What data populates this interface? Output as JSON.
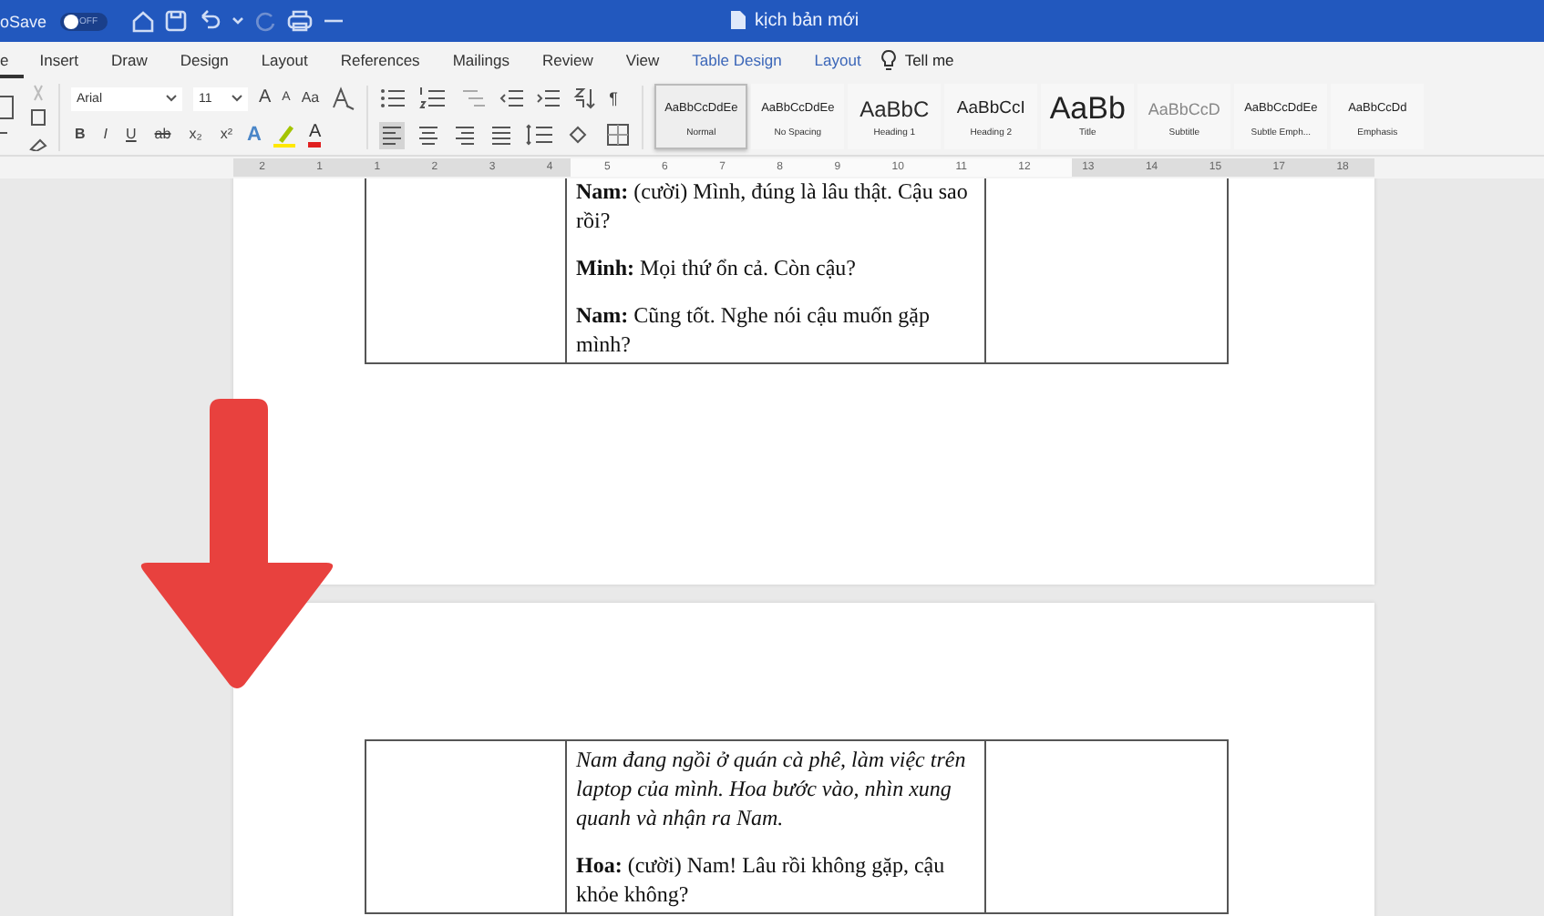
{
  "title_bar": {
    "autosave_label": "oSave",
    "autosave_toggle": {
      "label": "OFF",
      "on": false
    },
    "document_title": "kịch bản mới"
  },
  "tabs": [
    {
      "label": "e",
      "selected": true,
      "contextual": false
    },
    {
      "label": "Insert",
      "selected": false,
      "contextual": false
    },
    {
      "label": "Draw",
      "selected": false,
      "contextual": false
    },
    {
      "label": "Design",
      "selected": false,
      "contextual": false
    },
    {
      "label": "Layout",
      "selected": false,
      "contextual": false
    },
    {
      "label": "References",
      "selected": false,
      "contextual": false
    },
    {
      "label": "Mailings",
      "selected": false,
      "contextual": false
    },
    {
      "label": "Review",
      "selected": false,
      "contextual": false
    },
    {
      "label": "View",
      "selected": false,
      "contextual": false
    },
    {
      "label": "Table Design",
      "selected": false,
      "contextual": true
    },
    {
      "label": "Layout",
      "selected": false,
      "contextual": true
    }
  ],
  "tell_me": "Tell me",
  "ribbon": {
    "font_name": "Arial",
    "font_size": "11",
    "grow_font": "A",
    "shrink_font": "A",
    "change_case": "Aa",
    "format_buttons": [
      {
        "label": "B",
        "kind": "bold"
      },
      {
        "label": "I",
        "kind": "italic"
      },
      {
        "label": "U",
        "kind": "underline"
      },
      {
        "label": "ab",
        "kind": "strike"
      },
      {
        "label": "x₂",
        "kind": "sub"
      },
      {
        "label": "x²",
        "kind": "sup"
      }
    ],
    "text_effects": "A",
    "font_color": "A",
    "pilcrow": "¶",
    "alignment": [
      {
        "selected": true
      },
      {
        "selected": false
      },
      {
        "selected": false
      },
      {
        "selected": false
      }
    ],
    "styles": [
      {
        "preview": "AaBbCcDdEe",
        "name": "Normal",
        "kind": "small",
        "selected": true
      },
      {
        "preview": "AaBbCcDdEe",
        "name": "No Spacing",
        "kind": "small",
        "selected": false
      },
      {
        "preview": "AaBbC",
        "name": "Heading 1",
        "kind": "heading1",
        "selected": false
      },
      {
        "preview": "AaBbCcI",
        "name": "Heading 2",
        "kind": "heading2",
        "selected": false
      },
      {
        "preview": "AaBb",
        "name": "Title",
        "kind": "title",
        "selected": false
      },
      {
        "preview": "AaBbCcD",
        "name": "Subtitle",
        "kind": "subtitle",
        "selected": false
      },
      {
        "preview": "AaBbCcDdEe",
        "name": "Subtle Emph...",
        "kind": "small",
        "selected": false
      },
      {
        "preview": "AaBbCcDd",
        "name": "Emphasis",
        "kind": "small",
        "selected": false
      }
    ]
  },
  "ruler": [
    "2",
    "1",
    "1",
    "2",
    "3",
    "4",
    "5",
    "6",
    "7",
    "8",
    "9",
    "10",
    "11",
    "12",
    "13",
    "14",
    "15",
    "17",
    "18"
  ],
  "pages": [
    {
      "rows": [
        {
          "cells": [
            {},
            {
              "paragraphs": [
                {
                  "kind": "dialogue",
                  "text": "**Nam:** (cười) Mình, đúng là lâu thật. Cậu sao rồi?"
                },
                {
                  "kind": "dialogue",
                  "text": "**Minh:** Mọi thứ ổn cả. Còn cậu?"
                },
                {
                  "kind": "dialogue",
                  "text": "**Nam:** Cũng tốt. Nghe nói cậu muốn gặp mình?"
                }
              ]
            },
            {}
          ]
        }
      ]
    },
    {
      "rows": [
        {
          "cells": [
            {},
            {
              "paragraphs": [
                {
                  "kind": "action",
                  "text": "Nam đang ngồi ở quán cà phê, làm việc trên laptop của mình. Hoa bước vào, nhìn xung quanh và nhận ra Nam."
                },
                {
                  "kind": "dialogue",
                  "text": "**Hoa:** (cười) Nam! Lâu rồi không gặp, cậu khỏe không?"
                }
              ]
            },
            {}
          ]
        }
      ]
    }
  ]
}
